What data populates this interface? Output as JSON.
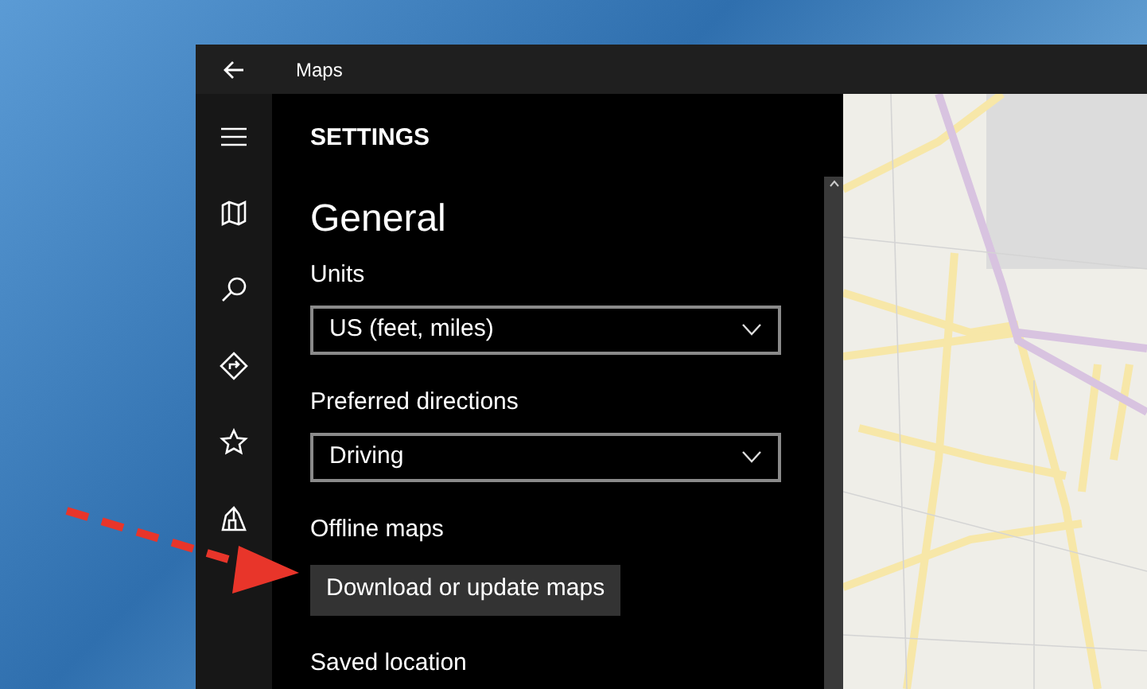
{
  "window": {
    "title": "Maps"
  },
  "settings": {
    "title": "SETTINGS",
    "section": "General",
    "items": [
      {
        "kind": "dropdown",
        "label": "Units",
        "value": "US (feet, miles)"
      },
      {
        "kind": "dropdown",
        "label": "Preferred directions",
        "value": "Driving"
      },
      {
        "kind": "button",
        "label": "Offline maps",
        "button": "Download or update maps"
      },
      {
        "kind": "heading",
        "label": "Saved location"
      }
    ]
  }
}
